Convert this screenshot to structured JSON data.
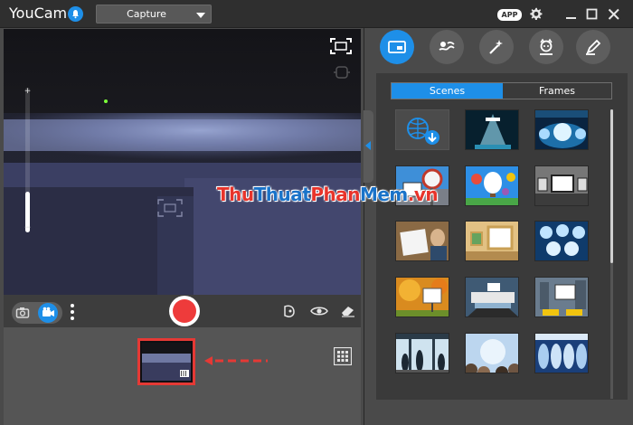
{
  "titlebar": {
    "app_title": "YouCam",
    "mode_select": "Capture",
    "app_badge": "APP"
  },
  "camera": {
    "mode_toggle": {
      "options": [
        "photo",
        "video"
      ],
      "selected": "video"
    }
  },
  "effects_panel": {
    "tools": [
      {
        "icon": "scene-icon",
        "active": true
      },
      {
        "icon": "distortion-icon",
        "active": false
      },
      {
        "icon": "magic-wand-icon",
        "active": false
      },
      {
        "icon": "avatar-icon",
        "active": false
      },
      {
        "icon": "brush-icon",
        "active": false
      }
    ],
    "tabs": [
      {
        "label": "Scenes",
        "selected": true
      },
      {
        "label": "Frames",
        "selected": false
      }
    ]
  },
  "watermark": {
    "parts": [
      "Thu",
      "Thuat",
      "Phan",
      "Mem",
      ".vn"
    ]
  },
  "colors": {
    "accent": "#1e8fe8",
    "record": "#ee3b3b",
    "highlight": "#e53935",
    "watermark_red": "#e8342b",
    "watermark_blue": "#1a73c9"
  }
}
